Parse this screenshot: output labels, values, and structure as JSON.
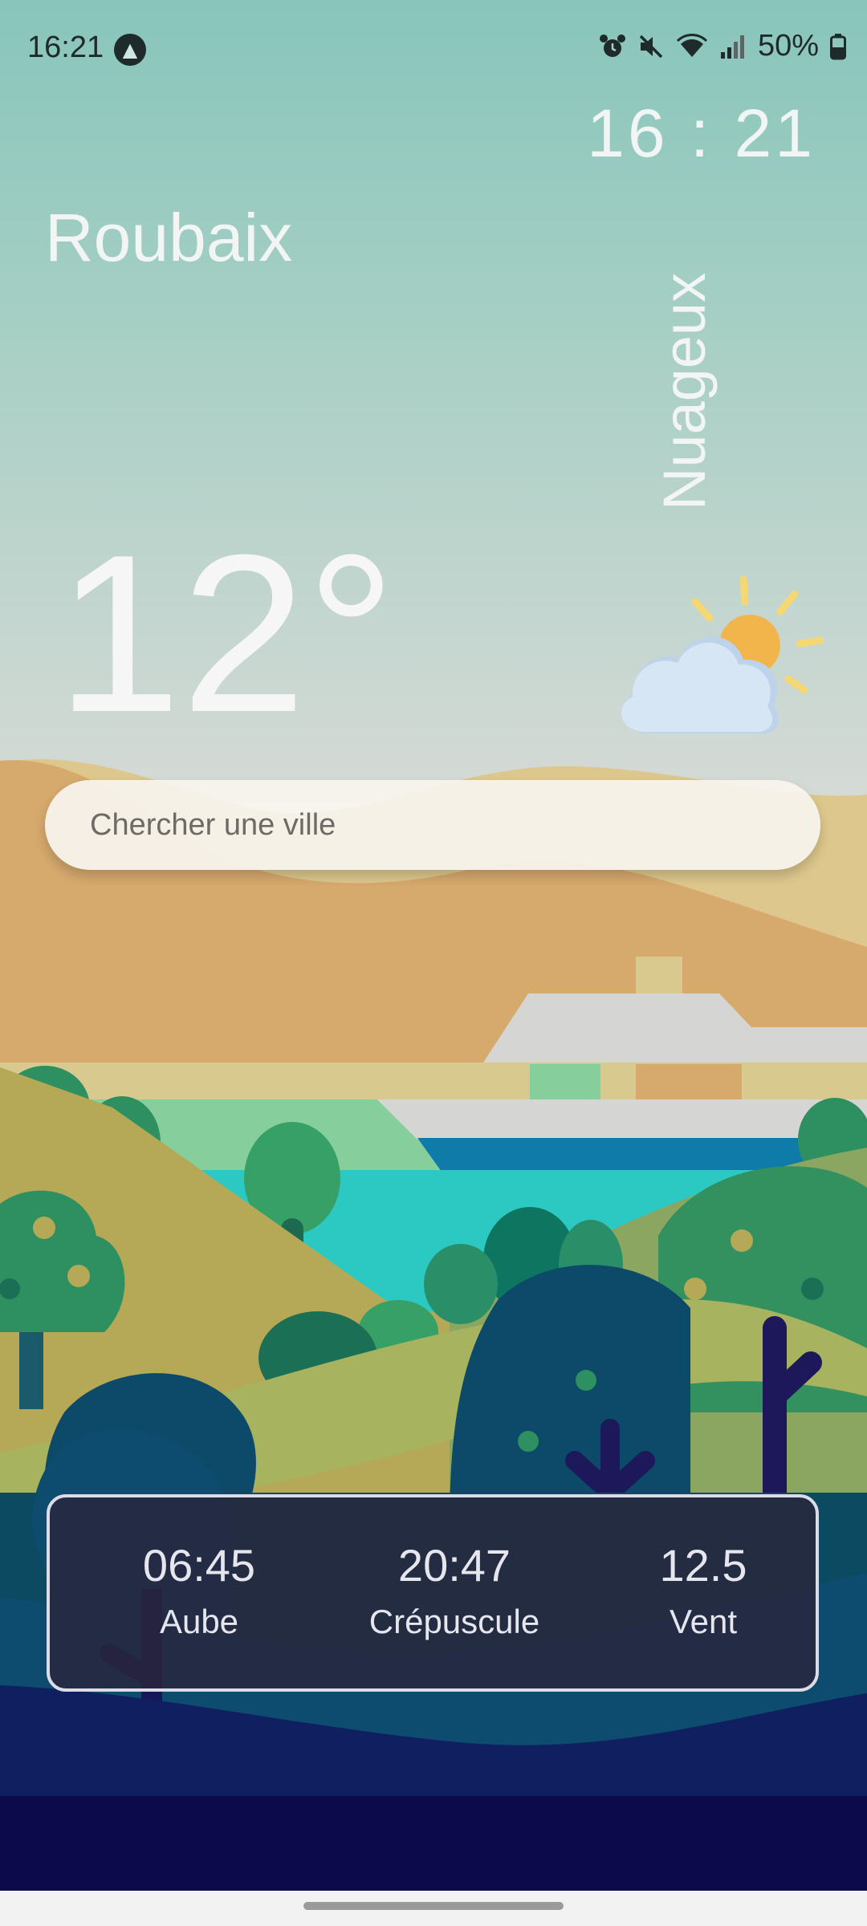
{
  "status_bar": {
    "time": "16:21",
    "battery": "50%",
    "icons": [
      "navigation-arrow-icon",
      "alarm-icon",
      "mute-icon",
      "wifi-icon",
      "signal-icon",
      "battery-icon"
    ]
  },
  "clock": "16 : 21",
  "city": "Roubaix",
  "condition": "Nuageux",
  "temperature": "12°",
  "weather_icon": "partly-cloudy-icon",
  "search": {
    "placeholder": "Chercher une ville"
  },
  "stats": [
    {
      "value": "06:45",
      "label": "Aube"
    },
    {
      "value": "20:47",
      "label": "Crépuscule"
    },
    {
      "value": "12.5",
      "label": "Vent"
    }
  ],
  "colors": {
    "sky_top": "#88c5bb",
    "hill_orange": "#d6a96d",
    "deep_navy": "#0d0a4b",
    "sun": "#f2b54c"
  }
}
